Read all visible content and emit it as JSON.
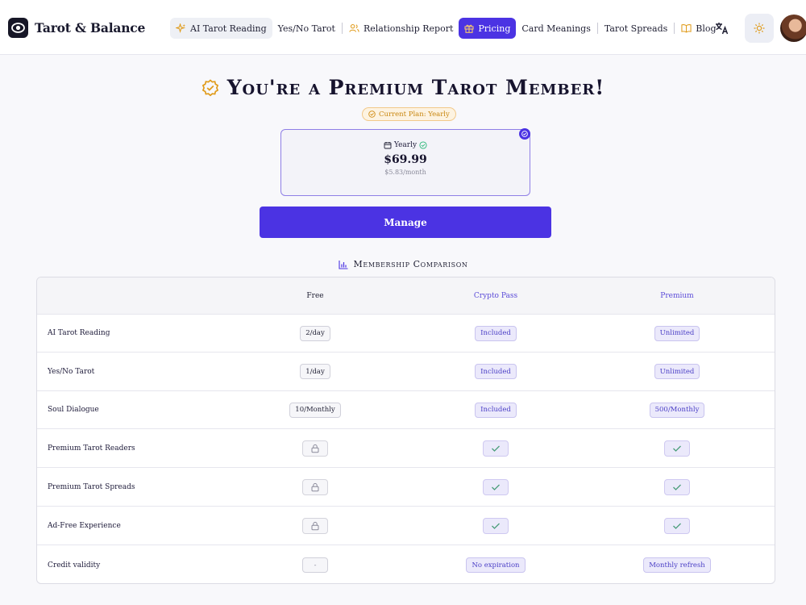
{
  "header": {
    "brand": "Tarot & Balance",
    "nav": [
      {
        "label": "AI Tarot Reading",
        "icon": "sparkle-icon"
      },
      {
        "label": "Yes/No Tarot",
        "icon": ""
      },
      {
        "label": "Relationship Report",
        "icon": "users-icon"
      },
      {
        "label": "Pricing",
        "icon": "gift-icon",
        "active": true
      },
      {
        "label": "Card Meanings",
        "icon": ""
      },
      {
        "label": "Tarot Spreads",
        "icon": ""
      },
      {
        "label": "Blog",
        "icon": "book-icon"
      }
    ],
    "translate_icon": "translate-icon",
    "theme_icon": "sun-icon"
  },
  "hero": {
    "title": "You're a Premium Tarot Member!",
    "current_plan": "Current Plan: Yearly"
  },
  "plan": {
    "name": "Yearly",
    "price": "$69.99",
    "per_month": "$5.83/month"
  },
  "manage_label": "Manage",
  "comparison": {
    "title": "Membership Comparison",
    "columns": [
      "Free",
      "Crypto Pass",
      "Premium"
    ],
    "rows": [
      {
        "feature": "AI Tarot Reading",
        "free": "2/day",
        "crypto": "Included",
        "premium": "Unlimited"
      },
      {
        "feature": "Yes/No Tarot",
        "free": "1/day",
        "crypto": "Included",
        "premium": "Unlimited"
      },
      {
        "feature": "Soul Dialogue",
        "free": "10/Monthly",
        "crypto": "Included",
        "premium": "500/Monthly"
      },
      {
        "feature": "Premium Tarot Readers",
        "free": "lock",
        "crypto": "check",
        "premium": "check"
      },
      {
        "feature": "Premium Tarot Spreads",
        "free": "lock",
        "crypto": "check",
        "premium": "check"
      },
      {
        "feature": "Ad-Free Experience",
        "free": "lock",
        "crypto": "check",
        "premium": "check"
      },
      {
        "feature": "Credit validity",
        "free": "-",
        "crypto": "No expiration",
        "premium": "Monthly refresh"
      }
    ]
  },
  "colors": {
    "accent": "#4b33e3",
    "gold": "#e09b1a"
  }
}
